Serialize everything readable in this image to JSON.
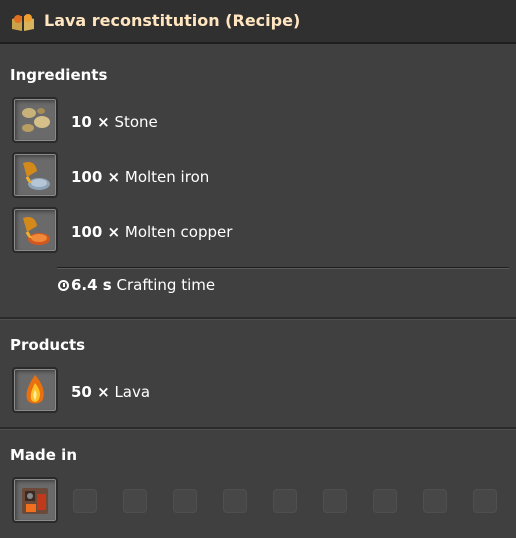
{
  "window": {
    "title": "Lava reconstitution (Recipe)"
  },
  "ingredients": {
    "heading": "Ingredients",
    "items": [
      {
        "amount": "10 ×",
        "name": "Stone",
        "icon": "stone-icon"
      },
      {
        "amount": "100 ×",
        "name": "Molten iron",
        "icon": "molten-iron-icon"
      },
      {
        "amount": "100 ×",
        "name": "Molten copper",
        "icon": "molten-copper-icon"
      }
    ],
    "crafting_time": {
      "value": "6.4 s",
      "label": "Crafting time"
    }
  },
  "products": {
    "heading": "Products",
    "items": [
      {
        "amount": "50 ×",
        "name": "Lava",
        "icon": "lava-icon"
      }
    ]
  },
  "made_in": {
    "heading": "Made in",
    "machine_icon": "foundry-icon",
    "empty_slots": 9
  },
  "colors": {
    "background": "#404040",
    "titlebar": "#313031",
    "title_text": "#ffe6c0"
  }
}
